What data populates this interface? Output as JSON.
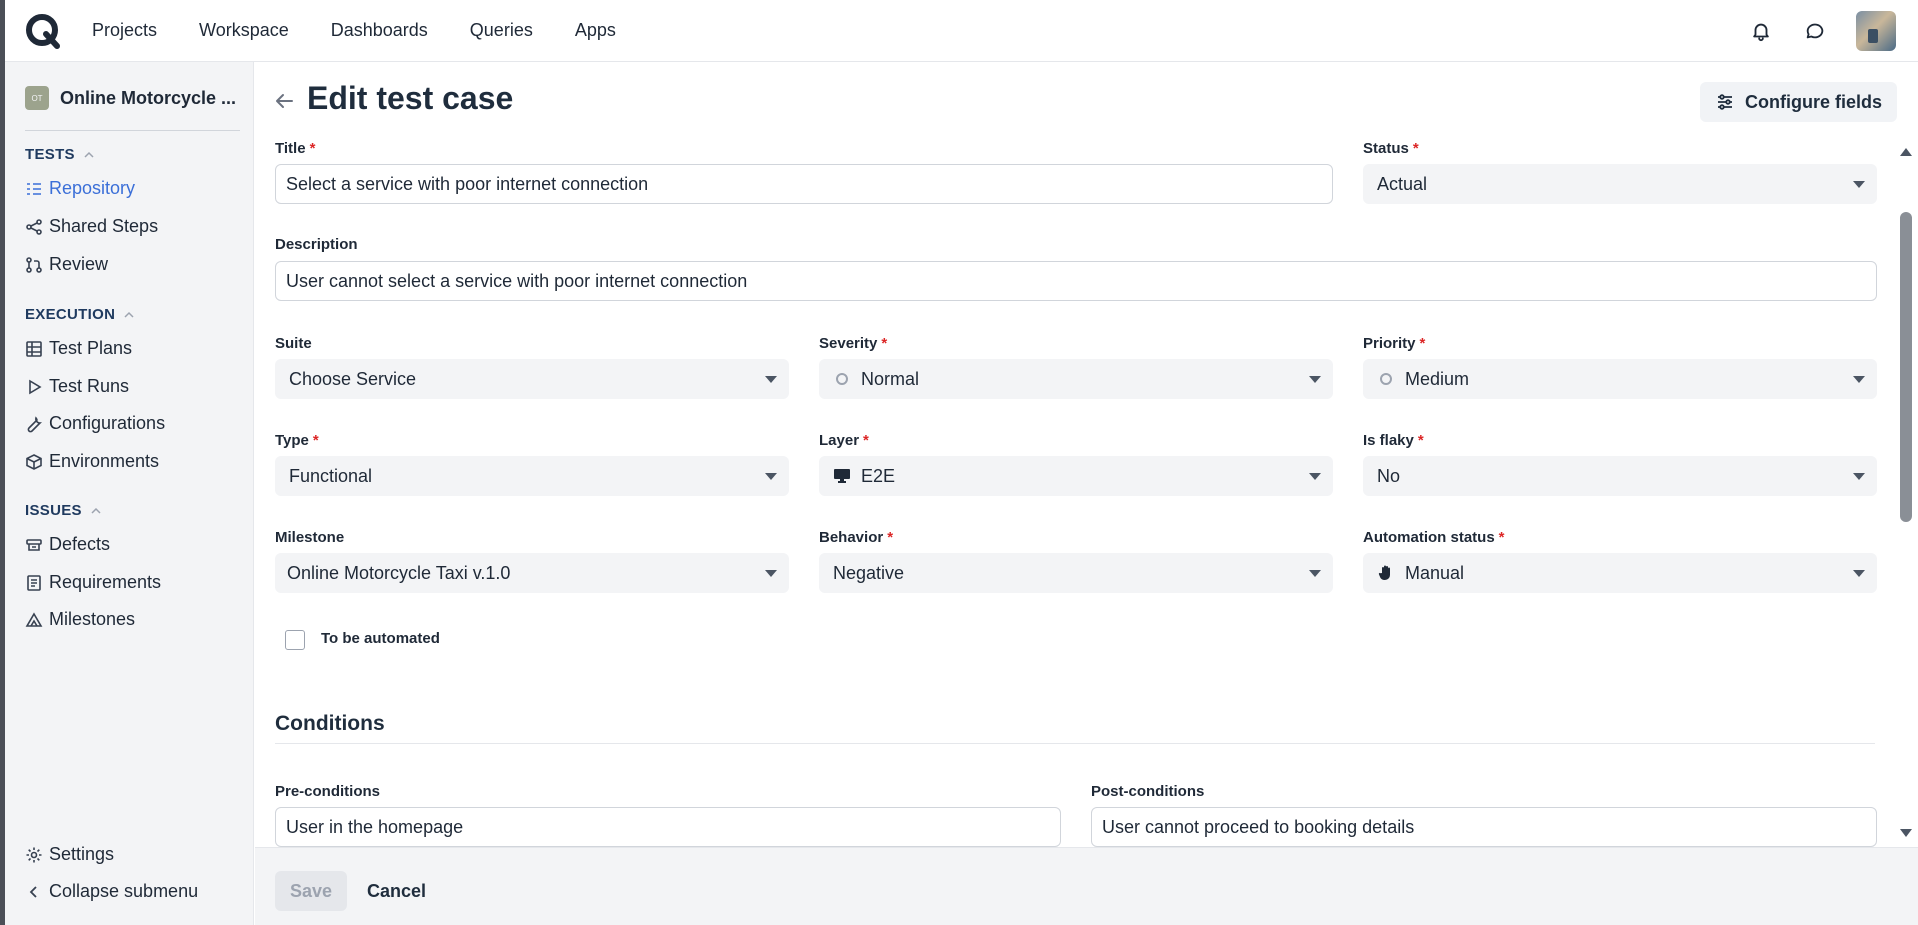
{
  "topnav": {
    "items": [
      "Projects",
      "Workspace",
      "Dashboards",
      "Queries",
      "Apps"
    ],
    "icons": [
      "bell-icon",
      "chat-icon"
    ]
  },
  "sidebar": {
    "project": {
      "badge": "OT",
      "name": "Online Motorcycle ..."
    },
    "sections": [
      {
        "title": "TESTS",
        "items": [
          "Repository",
          "Shared Steps",
          "Review"
        ]
      },
      {
        "title": "EXECUTION",
        "items": [
          "Test Plans",
          "Test Runs",
          "Configurations",
          "Environments"
        ]
      },
      {
        "title": "ISSUES",
        "items": [
          "Defects",
          "Requirements",
          "Milestones"
        ]
      }
    ],
    "bottom": [
      "Settings",
      "Collapse submenu"
    ],
    "active": "Repository"
  },
  "page": {
    "title": "Edit test case",
    "configure_fields": "Configure fields"
  },
  "form": {
    "title": {
      "label": "Title",
      "required": "*",
      "value": "Select a service with poor internet connection"
    },
    "status": {
      "label": "Status",
      "required": "*",
      "value": "Actual"
    },
    "description": {
      "label": "Description",
      "value": "User cannot select a service with poor internet connection"
    },
    "suite": {
      "label": "Suite",
      "value": "Choose Service"
    },
    "severity": {
      "label": "Severity",
      "required": "*",
      "value": "Normal"
    },
    "priority": {
      "label": "Priority",
      "required": "*",
      "value": "Medium"
    },
    "type": {
      "label": "Type",
      "required": "*",
      "value": "Functional"
    },
    "layer": {
      "label": "Layer",
      "required": "*",
      "value": "E2E"
    },
    "is_flaky": {
      "label": "Is flaky",
      "required": "*",
      "value": "No"
    },
    "milestone": {
      "label": "Milestone",
      "value": "Online Motorcycle Taxi v.1.0"
    },
    "behavior": {
      "label": "Behavior",
      "required": "*",
      "value": "Negative"
    },
    "automation_status": {
      "label": "Automation status",
      "required": "*",
      "value": "Manual"
    },
    "to_be_automated": {
      "label": "To be automated",
      "checked": false
    }
  },
  "conditions": {
    "title": "Conditions",
    "pre": {
      "label": "Pre-conditions",
      "value": "User in the homepage"
    },
    "post": {
      "label": "Post-conditions",
      "value": "User cannot proceed to booking details"
    }
  },
  "footer": {
    "save": "Save",
    "cancel": "Cancel"
  },
  "colors": {
    "accent": "#3b6fd8",
    "required": "#dc2626",
    "sidebar_bg": "#f3f4f6"
  }
}
